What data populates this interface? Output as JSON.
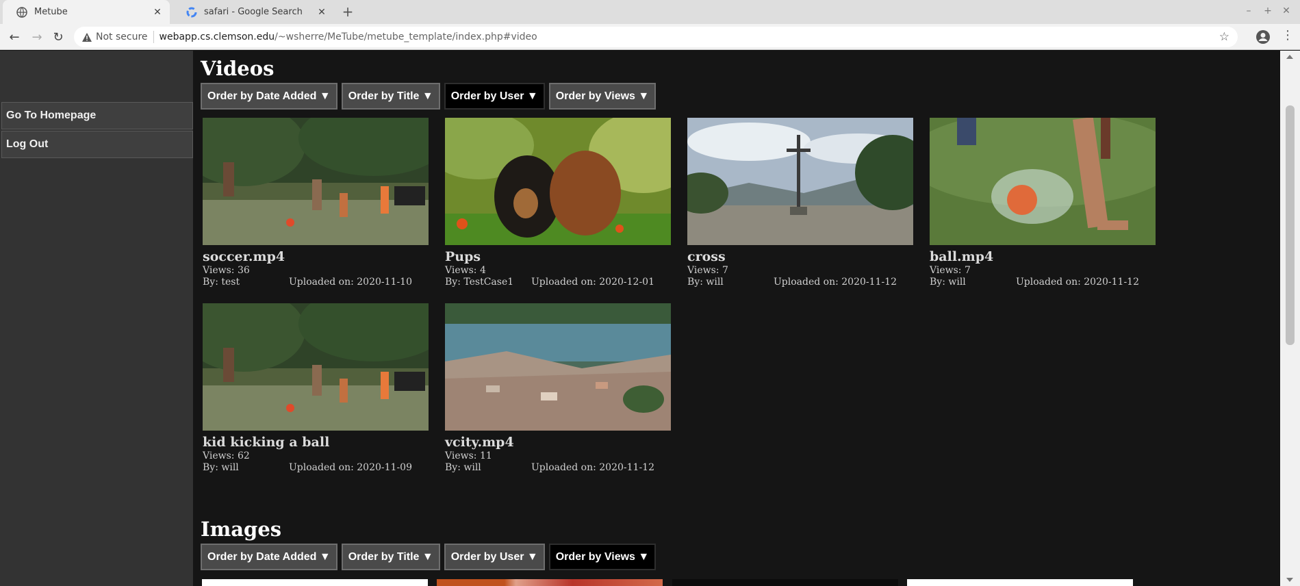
{
  "browser": {
    "tabs": [
      {
        "title": "Metube",
        "active": true
      },
      {
        "title": "safari - Google Search",
        "active": false
      }
    ],
    "omnibox": {
      "security": "Not secure",
      "host": "webapp.cs.clemson.edu",
      "path": "/~wsherre/MeTube/metube_template/index.php#video"
    }
  },
  "sidebar": {
    "items": [
      {
        "label": "Go To Homepage"
      },
      {
        "label": "Log Out"
      }
    ]
  },
  "videos": {
    "title": "Videos",
    "sort": [
      "Order by Date Added ▼",
      "Order by Title ▼",
      "Order by User ▼",
      "Order by Views ▼"
    ],
    "active_sort": 2,
    "items": [
      {
        "title": "soccer.mp4",
        "views": "Views: 36",
        "by": "By: test",
        "uploaded": "Uploaded on: 2020-11-10",
        "thumb": "soccer"
      },
      {
        "title": "Pups",
        "views": "Views: 4",
        "by": "By: TestCase1",
        "uploaded": "Uploaded on: 2020-12-01",
        "thumb": "pups"
      },
      {
        "title": "cross",
        "views": "Views: 7",
        "by": "By: will",
        "uploaded": "Uploaded on: 2020-11-12",
        "thumb": "cross"
      },
      {
        "title": "ball.mp4",
        "views": "Views: 7",
        "by": "By: will",
        "uploaded": "Uploaded on: 2020-11-12",
        "thumb": "ball"
      },
      {
        "title": "kid kicking a ball",
        "views": "Views: 62",
        "by": "By: will",
        "uploaded": "Uploaded on: 2020-11-09",
        "thumb": "soccer"
      },
      {
        "title": "vcity.mp4",
        "views": "Views: 11",
        "by": "By: will",
        "uploaded": "Uploaded on: 2020-11-12",
        "thumb": "city"
      }
    ]
  },
  "images": {
    "title": "Images",
    "sort": [
      "Order by Date Added ▼",
      "Order by Title ▼",
      "Order by User ▼",
      "Order by Views ▼"
    ],
    "active_sort": 3
  },
  "colors": {
    "page_bg": "#141414",
    "sidebar_bg": "#333333",
    "sort_active_bg": "#000000",
    "sort_bg": "#4a4a4a"
  }
}
